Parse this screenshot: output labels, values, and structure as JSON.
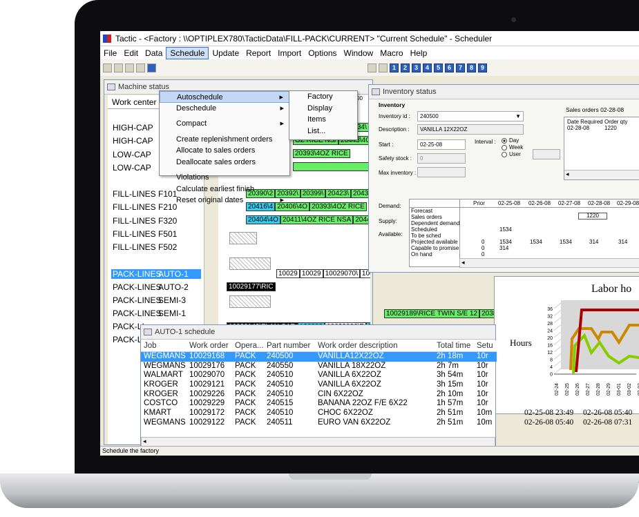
{
  "window": {
    "title": "Tactic - <Factory : \\\\OPTIPLEX780\\TacticData\\FILL-PACK\\CURRENT>  \"Current Schedule\" - Scheduler"
  },
  "menubar": [
    "File",
    "Edit",
    "Data",
    "Schedule",
    "Update",
    "Report",
    "Import",
    "Options",
    "Window",
    "Macro",
    "Help"
  ],
  "toolbar_numbers": [
    "1",
    "2",
    "3",
    "4",
    "5",
    "6",
    "7",
    "8",
    "9"
  ],
  "schedule_menu": {
    "items": [
      {
        "label": "Autoschedule",
        "submenu": true
      },
      {
        "label": "Deschedule",
        "submenu": true
      },
      {
        "label": "Compact",
        "submenu": true
      },
      {
        "label": "Create replenishment orders",
        "submenu": false
      },
      {
        "label": "Allocate to sales orders",
        "submenu": false
      },
      {
        "label": "Deallocate sales orders",
        "submenu": false
      },
      {
        "label": "Violations",
        "submenu": false
      },
      {
        "label": "Calculate earliest finish",
        "submenu": false
      },
      {
        "label": "Reset original dates",
        "submenu": true
      }
    ],
    "submenu": [
      "Factory",
      "Display",
      "Items",
      "List..."
    ]
  },
  "machine_status": {
    "title": "Machine status",
    "header": "Work center",
    "rows": [
      {
        "a": "HIGH-CAP",
        "b": ""
      },
      {
        "a": "HIGH-CAP",
        "b": ""
      },
      {
        "a": "LOW-CAP",
        "b": ""
      },
      {
        "a": "LOW-CAP",
        "b": ""
      },
      {
        "a": "FILL-LINES",
        "b": "F101"
      },
      {
        "a": "FILL-LINES",
        "b": "F210"
      },
      {
        "a": "FILL-LINES",
        "b": "F320"
      },
      {
        "a": "FILL-LINES",
        "b": "F501"
      },
      {
        "a": "FILL-LINES",
        "b": "F502"
      },
      {
        "a": "PACK-LINES",
        "b": "AUTO-1"
      },
      {
        "a": "PACK-LINES",
        "b": "AUTO-2"
      },
      {
        "a": "PACK-LINES",
        "b": "SEMI-3"
      },
      {
        "a": "PACK-LINES",
        "b": "SEMI-1"
      },
      {
        "a": "PACK-LI",
        "b": ""
      },
      {
        "a": "PACK-LI",
        "b": ""
      }
    ],
    "gantt_bars": [
      [
        "20399\\",
        "20423\\",
        "20434\\",
        "20"
      ],
      [
        "OZ RICE NS/",
        "20443\\4OZ"
      ],
      [
        "20393\\4OZ RICE"
      ],
      [
        ""
      ],
      [
        "20390\\2",
        "20392\\",
        "20399\\",
        "20423\\",
        "20434\\"
      ],
      [
        "20416\\4",
        "20406\\4O",
        "20393\\4OZ RICE"
      ],
      [
        "20404\\4O",
        "20411\\4OZ RICE NSA",
        "20443\\4"
      ],
      [
        "10029",
        "10029",
        "10029070\\",
        "1002912",
        "10029",
        "1002",
        "10029172\\CHOC"
      ],
      [
        "10029177\\RIC"
      ],
      [
        "10029189\\RICE TWIN S/E 12",
        "20380"
      ],
      [
        "10029142\\FLAN CAR",
        "100292",
        "10029026\\F",
        "10029142\\FLA"
      ]
    ],
    "grid_header": "00"
  },
  "inventory": {
    "title": "Inventory status",
    "section": "Inventory",
    "inventory_id_label": "Inventory id :",
    "inventory_id": "240500",
    "description_label": "Description :",
    "description": "VANILLA 12X22OZ",
    "start_label": "Start :",
    "start": "02-25-08",
    "interval_label": "Interval :",
    "interval_options": [
      "Day",
      "Week",
      "User"
    ],
    "safety_label": "Safety stock :",
    "safety": "0",
    "max_label": "Max inventory :",
    "sales_orders_title": "Sales orders 02-28-08",
    "sales_cols": [
      "Date Required",
      "Order qty"
    ],
    "sales_row": [
      "02-28-08",
      "1220"
    ],
    "grid_cols": [
      "Prior",
      "02-25-08",
      "02-26-08",
      "02-27-08",
      "02-28-08",
      "02-29-08"
    ],
    "group_labels": [
      "Demand:",
      "Supply:",
      "Available:"
    ],
    "row_labels": [
      "Forecast",
      "Sales orders",
      "Dependent demand",
      "Scheduled",
      "To be sched",
      "Projected available",
      "Capable to promise",
      "On hand"
    ],
    "sales_orders_value": "1220",
    "scheduled_value": "1534",
    "projected": [
      "0",
      "1534",
      "1534",
      "1534",
      "314",
      "314"
    ],
    "ctp": [
      "0",
      "314"
    ],
    "onhand": [
      "0"
    ]
  },
  "labor": {
    "title": "Labor ho",
    "ylabel": "Hours",
    "yticks": [
      "36",
      "32",
      "28",
      "24",
      "20",
      "16",
      "12",
      "8",
      "4",
      "0"
    ],
    "xticks": [
      "02-24",
      "02-25",
      "02-26",
      "02-27",
      "02-28",
      "02-29",
      "03-01",
      "03-02",
      "03-03"
    ]
  },
  "auto_schedule": {
    "title": "AUTO-1 schedule",
    "columns": [
      "Job",
      "Work order",
      "Opera...",
      "Part number",
      "Work order description",
      "Total time",
      "Setu"
    ],
    "rows": [
      [
        "WEGMANS",
        "10029168",
        "PACK",
        "240500",
        "VANILLA12X22OZ",
        "2h 18m",
        "10r",
        "",
        ""
      ],
      [
        "WEGMANS",
        "10029176",
        "PACK",
        "240550",
        "VANILLA 18X22OZ",
        "2h 7m",
        "10r",
        "",
        ""
      ],
      [
        "WALMART",
        "10029070",
        "PACK",
        "240510",
        "VANILLA 6X22OZ",
        "3h 54m",
        "10r",
        "",
        ""
      ],
      [
        "KROGER",
        "10029121",
        "PACK",
        "240510",
        "VANILLA 6X22OZ",
        "3h 15m",
        "10r",
        "",
        ""
      ],
      [
        "KROGER",
        "10029226",
        "PACK",
        "240510",
        "CIN 6X22OZ",
        "2h 10m",
        "10r",
        "",
        ""
      ],
      [
        "COSTCO",
        "10029229",
        "PACK",
        "240515",
        "BANANA 22OZ F/E 6X22",
        "1h 57m",
        "10r",
        "",
        ""
      ],
      [
        "KMART",
        "10029172",
        "PACK",
        "240510",
        "CHOC 6X22OZ",
        "2h 51m",
        "10m",
        "02-25-08 23:49",
        "02-26-08 05:40"
      ],
      [
        "WEGMANS",
        "10029122",
        "PACK",
        "240511",
        "EURO VAN 6X22OZ",
        "2h 51m",
        "10m",
        "02-26-08 05:40",
        "02-26-08 07:31"
      ]
    ]
  },
  "status_bar": "Schedule the factory"
}
